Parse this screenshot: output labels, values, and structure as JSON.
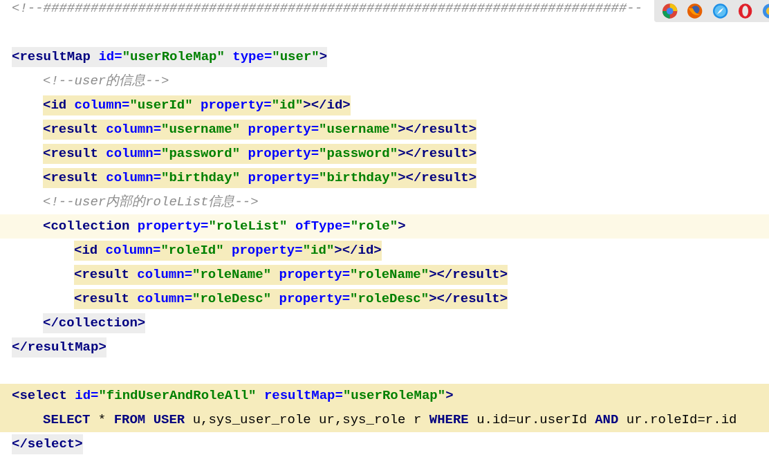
{
  "lines": [
    {
      "kind": "plain",
      "tokens": [
        {
          "kind": "comment",
          "text": "<!--##########################################################################--"
        }
      ]
    },
    {
      "kind": "blank"
    },
    {
      "kind": "enclosing",
      "tokens": [
        {
          "kind": "tag",
          "text": "<resultMap"
        },
        {
          "kind": "attr",
          "text": " id="
        },
        {
          "kind": "value",
          "text": "\"userRoleMap\""
        },
        {
          "kind": "attr",
          "text": " type="
        },
        {
          "kind": "value",
          "text": "\"user\""
        },
        {
          "kind": "tag",
          "text": ">"
        }
      ],
      "children": [
        {
          "kind": "plain",
          "tokens": [
            {
              "kind": "comment",
              "text": "<!--user的信息-->"
            }
          ]
        },
        {
          "kind": "matched",
          "tokens": [
            {
              "kind": "tag",
              "text": "<id"
            },
            {
              "kind": "attr",
              "text": " column="
            },
            {
              "kind": "value",
              "text": "\"userId\""
            },
            {
              "kind": "attr",
              "text": " property="
            },
            {
              "kind": "value",
              "text": "\"id\""
            },
            {
              "kind": "tag",
              "text": "></id>"
            }
          ]
        },
        {
          "kind": "matched",
          "tokens": [
            {
              "kind": "tag",
              "text": "<result"
            },
            {
              "kind": "attr",
              "text": " column="
            },
            {
              "kind": "value",
              "text": "\"username\""
            },
            {
              "kind": "attr",
              "text": " property="
            },
            {
              "kind": "value",
              "text": "\"username\""
            },
            {
              "kind": "tag",
              "text": "></result>"
            }
          ]
        },
        {
          "kind": "matched",
          "tokens": [
            {
              "kind": "tag",
              "text": "<result"
            },
            {
              "kind": "attr",
              "text": " column="
            },
            {
              "kind": "value",
              "text": "\"password\""
            },
            {
              "kind": "attr",
              "text": " property="
            },
            {
              "kind": "value",
              "text": "\"password\""
            },
            {
              "kind": "tag",
              "text": "></result>"
            }
          ]
        },
        {
          "kind": "matched",
          "tokens": [
            {
              "kind": "tag",
              "text": "<result"
            },
            {
              "kind": "attr",
              "text": " column="
            },
            {
              "kind": "value",
              "text": "\"birthday\""
            },
            {
              "kind": "attr",
              "text": " property="
            },
            {
              "kind": "value",
              "text": "\"birthday\""
            },
            {
              "kind": "tag",
              "text": "></result>"
            }
          ]
        },
        {
          "kind": "plain",
          "tokens": [
            {
              "kind": "comment",
              "text": "<!--user内部的roleList信息-->"
            }
          ]
        },
        {
          "kind": "current",
          "tokens": [
            {
              "kind": "tag",
              "text": "<collection"
            },
            {
              "kind": "attr",
              "text": " property="
            },
            {
              "kind": "value",
              "text": "\"roleList\""
            },
            {
              "kind": "attr",
              "text": " ofType="
            },
            {
              "kind": "value",
              "text": "\"role\""
            },
            {
              "kind": "tag",
              "text": ">"
            }
          ],
          "children": [
            {
              "kind": "matched",
              "tokens": [
                {
                  "kind": "tag",
                  "text": "<id"
                },
                {
                  "kind": "attr",
                  "text": " column="
                },
                {
                  "kind": "value",
                  "text": "\"roleId\""
                },
                {
                  "kind": "attr",
                  "text": " property="
                },
                {
                  "kind": "value",
                  "text": "\"id\""
                },
                {
                  "kind": "tag",
                  "text": "></id>"
                }
              ]
            },
            {
              "kind": "matched",
              "tokens": [
                {
                  "kind": "tag",
                  "text": "<result"
                },
                {
                  "kind": "attr",
                  "text": " column="
                },
                {
                  "kind": "value",
                  "text": "\"roleName\""
                },
                {
                  "kind": "attr",
                  "text": " property="
                },
                {
                  "kind": "value",
                  "text": "\"roleName\""
                },
                {
                  "kind": "tag",
                  "text": "></result>"
                }
              ]
            },
            {
              "kind": "matched",
              "tokens": [
                {
                  "kind": "tag",
                  "text": "<result"
                },
                {
                  "kind": "attr",
                  "text": " column="
                },
                {
                  "kind": "value",
                  "text": "\"roleDesc\""
                },
                {
                  "kind": "attr",
                  "text": " property="
                },
                {
                  "kind": "value",
                  "text": "\"roleDesc\""
                },
                {
                  "kind": "tag",
                  "text": "></result>"
                }
              ]
            }
          ]
        },
        {
          "kind": "enclosing",
          "tokens": [
            {
              "kind": "tag",
              "text": "</collection>"
            }
          ]
        }
      ]
    },
    {
      "kind": "enclosing",
      "tokens": [
        {
          "kind": "tag",
          "text": "</resultMap>"
        }
      ]
    },
    {
      "kind": "blank"
    },
    {
      "kind": "injected",
      "tokens": [
        {
          "kind": "tag",
          "text": "<select"
        },
        {
          "kind": "attr",
          "text": " id="
        },
        {
          "kind": "value",
          "text": "\"findUserAndRoleAll\""
        },
        {
          "kind": "attr",
          "text": " resultMap="
        },
        {
          "kind": "value",
          "text": "\"userRoleMap\""
        },
        {
          "kind": "tag",
          "text": ">"
        }
      ],
      "children": [
        {
          "kind": "injected",
          "tokens": [
            {
              "kind": "keyword",
              "text": "SELECT"
            },
            {
              "kind": "plain",
              "text": " * "
            },
            {
              "kind": "keyword",
              "text": "FROM USER"
            },
            {
              "kind": "plain",
              "text": " u,sys_user_role ur,sys_role r "
            },
            {
              "kind": "keyword",
              "text": "WHERE"
            },
            {
              "kind": "plain",
              "text": " u.id=ur.userId "
            },
            {
              "kind": "keyword",
              "text": "AND"
            },
            {
              "kind": "plain",
              "text": " ur.roleId=r.id"
            }
          ]
        }
      ]
    },
    {
      "kind": "enclosing",
      "tokens": [
        {
          "kind": "tag",
          "text": "</select>"
        }
      ]
    }
  ]
}
